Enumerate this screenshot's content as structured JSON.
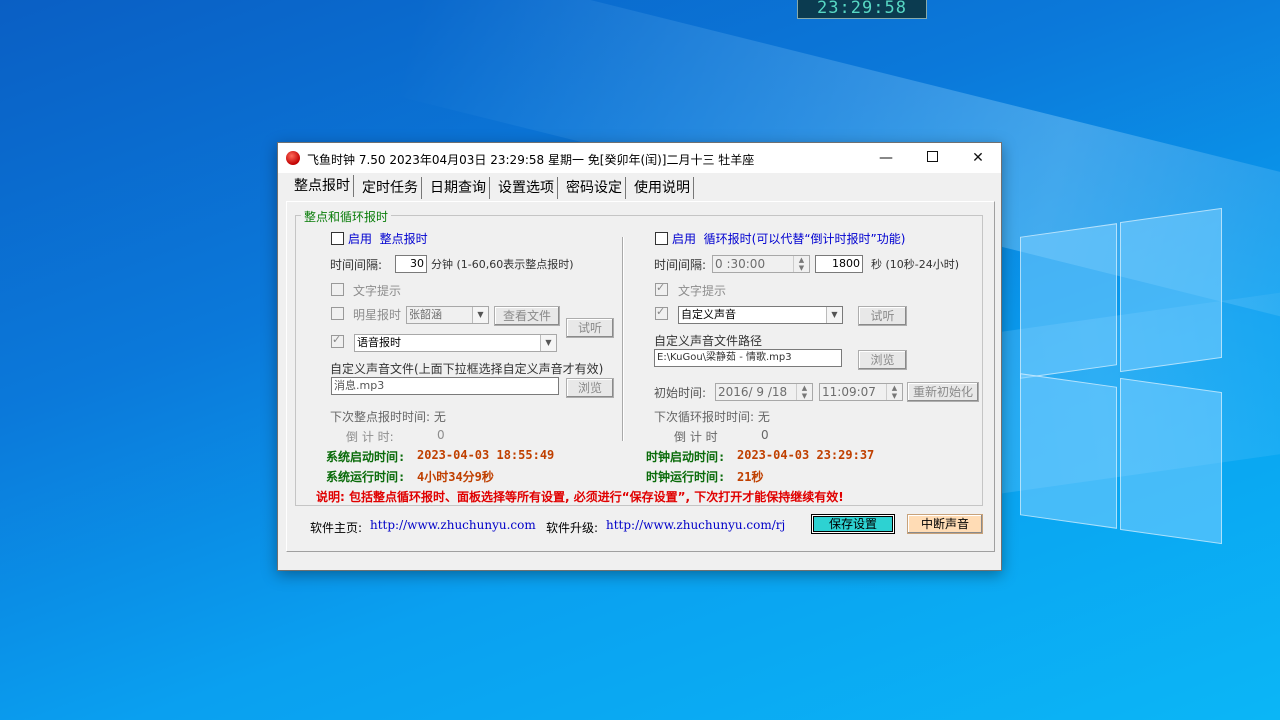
{
  "desktop": {
    "clock": "23:29:58"
  },
  "window": {
    "title": "飞鱼时钟 7.50 2023年04月03日 23:29:58 星期一 免[癸卯年(闰)]二月十三 牡羊座",
    "controls": {
      "minimize": "—",
      "close": "✕"
    }
  },
  "tabs": [
    "整点报时",
    "定时任务",
    "日期查询",
    "设置选项",
    "密码设定",
    "使用说明"
  ],
  "group_title": "整点和循环报时",
  "left": {
    "enable_prefix": "启用",
    "enable_name": "整点报时",
    "interval_label": "时间间隔:",
    "interval_value": "30",
    "interval_unit": "分钟 (1-60,60表示整点报时)",
    "text_tip": "文字提示",
    "star_label": "明星报时",
    "star_value": "张韶涵",
    "view_file": "查看文件",
    "audition": "试听",
    "voice_value": "语音报时",
    "custom_file_label": "自定义声音文件(上面下拉框选择自定义声音才有效)",
    "custom_file_value": "消息.mp3",
    "browse": "浏览",
    "next_label": "下次整点报时时间:",
    "next_value": "无",
    "countdown_label": "倒 计 时:",
    "countdown_value": "0",
    "sys_start_label": "系统启动时间:",
    "sys_start_value": "2023-04-03 18:55:49",
    "sys_run_label": "系统运行时间:",
    "sys_run_value": "4小时34分9秒"
  },
  "right": {
    "enable_prefix": "启用",
    "enable_name": "循环报时(可以代替“倒计时报时”功能)",
    "interval_label": "时间间隔:",
    "interval_time": "0 :30:00",
    "interval_seconds": "1800",
    "interval_unit": "秒 (10秒-24小时)",
    "text_tip": "文字提示",
    "sound_value": "自定义声音",
    "audition": "试听",
    "path_label": "自定义声音文件路径",
    "path_value": "E:\\KuGou\\梁静茹 - 情歌.mp3",
    "browse": "浏览",
    "start_label": "初始时间:",
    "start_date": "2016/ 9 /18",
    "start_time": "11:09:07",
    "reinit": "重新初始化",
    "next_label": "下次循环报时时间:",
    "next_value": "无",
    "countdown_label": "倒 计 时",
    "countdown_value": "0",
    "clock_start_label": "时钟启动时间:",
    "clock_start_value": "2023-04-03 23:29:37",
    "clock_run_label": "时钟运行时间:",
    "clock_run_value": "21秒"
  },
  "note": "说明: 包括整点循环报时、面板选择等所有设置, 必须进行“保存设置”, 下次打开才能保持继续有效!",
  "footer": {
    "home_label": "软件主页:",
    "home_url": "http://www.zhuchunyu.com",
    "upgrade_label": "软件升级:",
    "upgrade_url": "http://www.zhuchunyu.com/rj",
    "save": "保存设置",
    "stop_sound": "中断声音"
  },
  "colors": {
    "accent_save": "#2dd2d2",
    "stop_bg": "#ffdcb5",
    "note_red": "#e00000",
    "label_green": "#0a6b0a"
  }
}
